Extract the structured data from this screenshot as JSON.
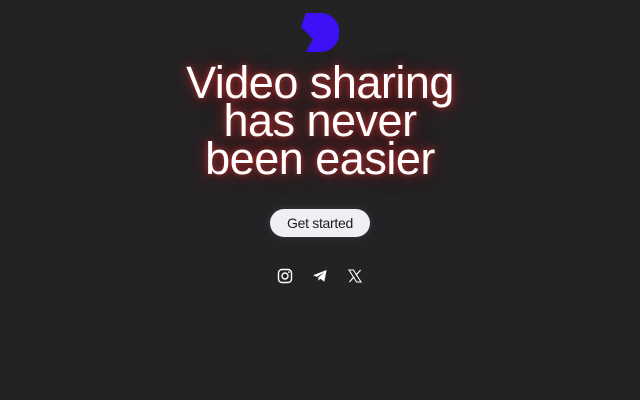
{
  "brand": {
    "logo_icon": "brand-logo-icon",
    "logo_color": "#3d10f5"
  },
  "hero": {
    "headline_lines": [
      "Video sharing",
      "has never",
      "been easier"
    ],
    "glow_color": "#e02828"
  },
  "cta": {
    "label": "Get started"
  },
  "social": {
    "items": [
      {
        "icon": "instagram-icon"
      },
      {
        "icon": "telegram-icon"
      },
      {
        "icon": "x-icon"
      }
    ]
  },
  "colors": {
    "background": "#232224",
    "text": "#ffffff",
    "button_bg": "#f1eff6",
    "button_text": "#1c1b1f"
  }
}
